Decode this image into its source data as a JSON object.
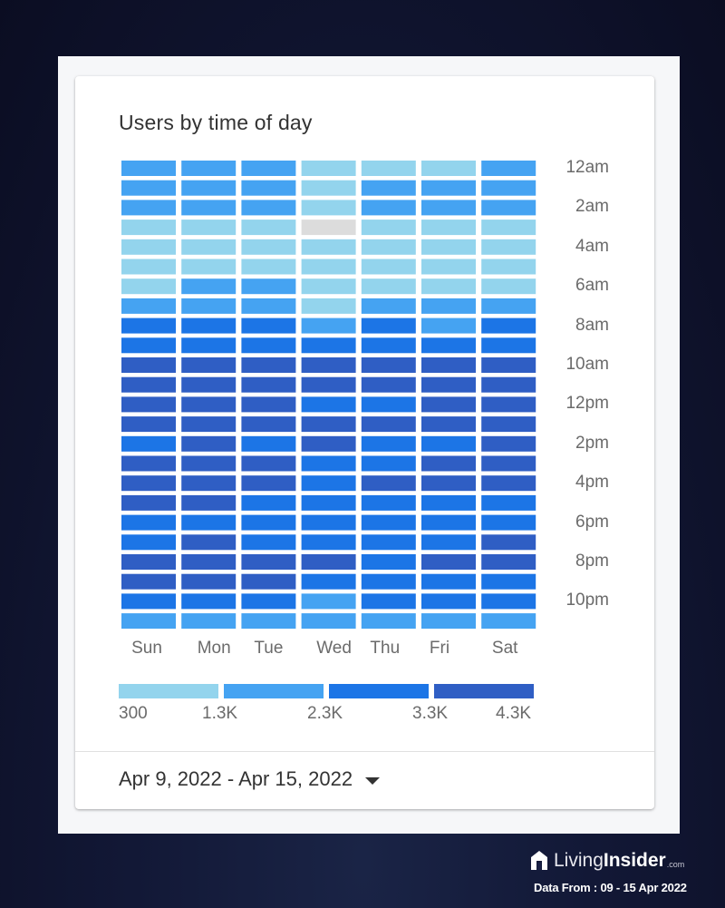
{
  "card": {
    "title": "Users by time of day",
    "date_range": "Apr 9, 2022 - Apr 15, 2022",
    "date_range_icon": "caret-down-icon"
  },
  "branding": {
    "logo_icon": "house-logo-icon",
    "name_light": "Living",
    "name_bold": "Insider",
    "name_suffix": ".com",
    "source_note": "Data From : 09 - 15 Apr 2022"
  },
  "chart_data": {
    "type": "heatmap",
    "title": "Users by time of day",
    "xlabel": "",
    "ylabel": "",
    "x_categories": [
      "Sun",
      "Mon",
      "Tue",
      "Wed",
      "Thu",
      "Fri",
      "Sat"
    ],
    "y_categories": [
      "12am",
      "1am",
      "2am",
      "3am",
      "4am",
      "5am",
      "6am",
      "7am",
      "8am",
      "9am",
      "10am",
      "11am",
      "12pm",
      "1pm",
      "2pm",
      "3pm",
      "4pm",
      "5pm",
      "6pm",
      "7pm",
      "8pm",
      "9pm",
      "10pm",
      "11pm"
    ],
    "y_tick_labels": [
      "12am",
      "2am",
      "4am",
      "6am",
      "8am",
      "10am",
      "12pm",
      "2pm",
      "4pm",
      "6pm",
      "8pm",
      "10pm"
    ],
    "y_label_position": "right",
    "legend": {
      "position": "bottom",
      "tick_labels": [
        "300",
        "1.3K",
        "2.3K",
        "3.3K",
        "4.3K"
      ],
      "bins": [
        {
          "range": [
            300,
            1300
          ],
          "color": "#93d4ed"
        },
        {
          "range": [
            1300,
            2300
          ],
          "color": "#45a3f2"
        },
        {
          "range": [
            2300,
            3300
          ],
          "color": "#1c75e6"
        },
        {
          "range": [
            3300,
            4300
          ],
          "color": "#2f5ec4"
        }
      ],
      "no_data_color": "#dcdcdc"
    },
    "value_encoding": "legend bin index (0-3), null = no data",
    "values": [
      [
        1,
        1,
        1,
        0,
        0,
        0,
        1
      ],
      [
        1,
        1,
        1,
        0,
        1,
        1,
        1
      ],
      [
        1,
        1,
        1,
        0,
        1,
        1,
        1
      ],
      [
        0,
        0,
        0,
        null,
        0,
        0,
        0
      ],
      [
        0,
        0,
        0,
        0,
        0,
        0,
        0
      ],
      [
        0,
        0,
        0,
        0,
        0,
        0,
        0
      ],
      [
        0,
        1,
        1,
        0,
        0,
        0,
        0
      ],
      [
        1,
        1,
        1,
        0,
        1,
        1,
        1
      ],
      [
        2,
        2,
        2,
        1,
        2,
        1,
        2
      ],
      [
        2,
        2,
        2,
        2,
        2,
        2,
        2
      ],
      [
        3,
        3,
        3,
        3,
        3,
        3,
        3
      ],
      [
        3,
        3,
        3,
        3,
        3,
        3,
        3
      ],
      [
        3,
        3,
        3,
        2,
        2,
        3,
        3
      ],
      [
        3,
        3,
        3,
        3,
        3,
        3,
        3
      ],
      [
        2,
        3,
        2,
        3,
        2,
        2,
        3
      ],
      [
        3,
        3,
        3,
        2,
        2,
        3,
        3
      ],
      [
        3,
        3,
        3,
        2,
        3,
        3,
        3
      ],
      [
        3,
        3,
        2,
        2,
        2,
        2,
        2
      ],
      [
        2,
        2,
        2,
        2,
        2,
        2,
        2
      ],
      [
        2,
        3,
        2,
        2,
        2,
        2,
        3
      ],
      [
        3,
        3,
        3,
        3,
        2,
        3,
        3
      ],
      [
        3,
        3,
        3,
        2,
        2,
        2,
        2
      ],
      [
        2,
        2,
        2,
        1,
        2,
        2,
        2
      ],
      [
        1,
        1,
        1,
        1,
        1,
        1,
        1
      ]
    ]
  }
}
